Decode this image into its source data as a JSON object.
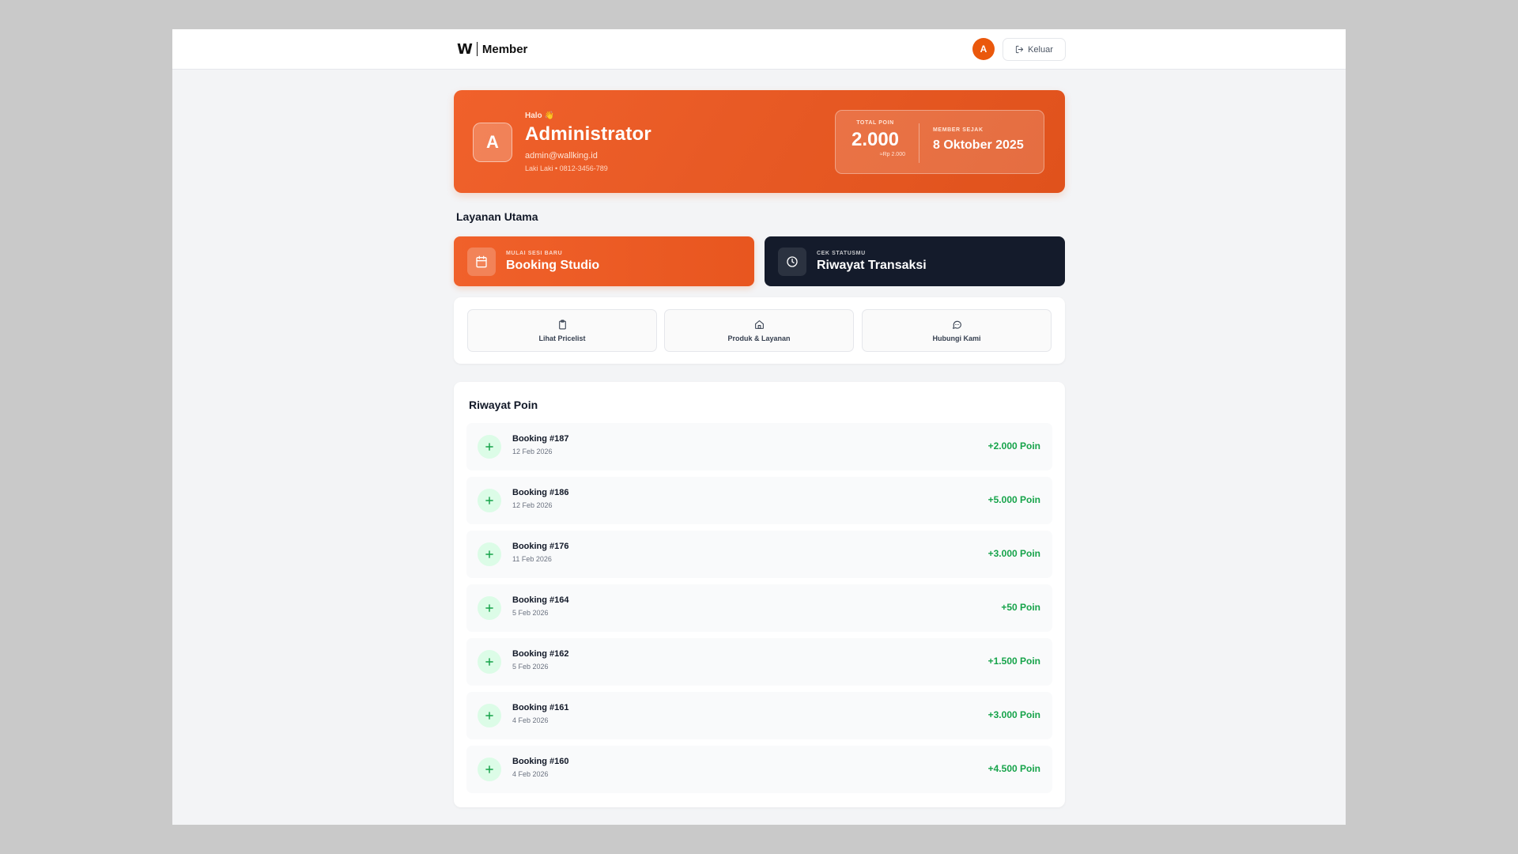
{
  "header": {
    "logo_text": "W",
    "brand_label": "Member",
    "avatar_initial": "A",
    "logout_label": "Keluar"
  },
  "profile": {
    "greeting": "Halo 👋",
    "name": "Administrator",
    "email": "admin@wallking.id",
    "meta": "Laki Laki • 0812-3456-789",
    "initial": "A",
    "total_points_label": "TOTAL POIN",
    "total_points": "2.000",
    "points_value": "≈Rp 2.000",
    "member_since_label": "MEMBER SEJAK",
    "member_since": "8 Oktober 2025"
  },
  "services": {
    "section_title": "Layanan Utama",
    "booking": {
      "kicker": "MULAI SESI BARU",
      "title": "Booking Studio",
      "icon": "calendar-icon"
    },
    "history": {
      "kicker": "CEK STATUSMU",
      "title": "Riwayat Transaksi",
      "icon": "clock-icon"
    }
  },
  "quick_links": [
    {
      "label": "Lihat Pricelist",
      "icon": "clipboard-icon"
    },
    {
      "label": "Produk & Layanan",
      "icon": "home-icon"
    },
    {
      "label": "Hubungi Kami",
      "icon": "chat-icon"
    }
  ],
  "points_history": {
    "title": "Riwayat Poin",
    "items": [
      {
        "title": "Booking #187",
        "date": "12 Feb 2026",
        "points": "+2.000 Poin"
      },
      {
        "title": "Booking #186",
        "date": "12 Feb 2026",
        "points": "+5.000 Poin"
      },
      {
        "title": "Booking #176",
        "date": "11 Feb 2026",
        "points": "+3.000 Poin"
      },
      {
        "title": "Booking #164",
        "date": "5 Feb 2026",
        "points": "+50 Poin"
      },
      {
        "title": "Booking #162",
        "date": "5 Feb 2026",
        "points": "+1.500 Poin"
      },
      {
        "title": "Booking #161",
        "date": "4 Feb 2026",
        "points": "+3.000 Poin"
      },
      {
        "title": "Booking #160",
        "date": "4 Feb 2026",
        "points": "+4.500 Poin"
      }
    ]
  },
  "colors": {
    "accent": "#ea580c",
    "dark_card": "#141b2b",
    "positive": "#16a34a"
  }
}
